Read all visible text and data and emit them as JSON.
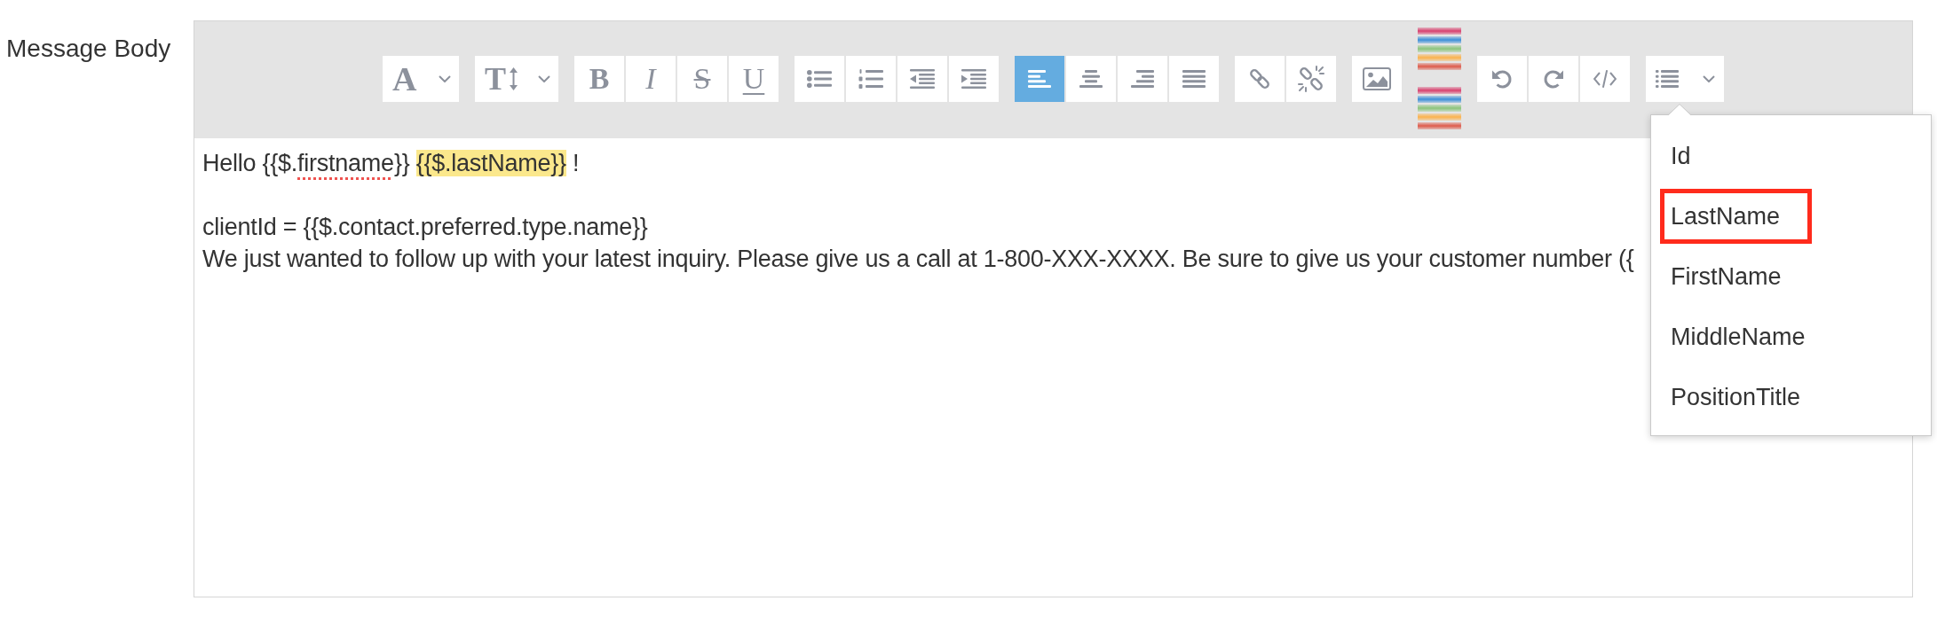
{
  "form_field": {
    "label": "Message Body"
  },
  "toolbar": {
    "groups": [
      {
        "items": [
          {
            "kind": "font",
            "label": "A"
          }
        ]
      },
      {
        "items": [
          {
            "kind": "size",
            "label": "T"
          }
        ]
      },
      {
        "items": [
          {
            "kind": "bold",
            "label": "B"
          },
          {
            "kind": "italic",
            "label": "I"
          },
          {
            "kind": "strike",
            "label": "S"
          },
          {
            "kind": "underline",
            "label": "U"
          }
        ]
      },
      {
        "items": [
          {
            "kind": "bullets"
          },
          {
            "kind": "numbers"
          },
          {
            "kind": "outdent"
          },
          {
            "kind": "indent"
          }
        ]
      },
      {
        "items": [
          {
            "kind": "left",
            "selected": true
          },
          {
            "kind": "center",
            "selected": false
          },
          {
            "kind": "right",
            "selected": false
          },
          {
            "kind": "justify",
            "selected": false
          }
        ]
      },
      {
        "items": [
          {
            "kind": "link"
          },
          {
            "kind": "unlink"
          }
        ]
      },
      {
        "items": [
          {
            "kind": "image"
          }
        ]
      },
      {
        "items": [
          {
            "kind": "palette"
          },
          {
            "kind": "palette"
          }
        ]
      },
      {
        "items": [
          {
            "kind": "undo"
          },
          {
            "kind": "redo"
          },
          {
            "kind": "code"
          }
        ]
      },
      {
        "items": [
          {
            "kind": "fields",
            "expanded": true
          }
        ]
      }
    ]
  },
  "editor": {
    "lines": [
      {
        "kind": "text",
        "segments": [
          {
            "kind": "plain",
            "text": "Hello {{$."
          },
          {
            "kind": "misspelled",
            "text": "firstname"
          },
          {
            "kind": "plain",
            "text": "}} "
          },
          {
            "kind": "highlight",
            "text": "{{$.lastName}}"
          },
          {
            "kind": "plain",
            "text": " !"
          }
        ]
      },
      {
        "kind": "blank"
      },
      {
        "kind": "text",
        "segments": [
          {
            "kind": "plain",
            "text": "clientId = {{$.contact.preferred.type.name}}"
          }
        ]
      },
      {
        "kind": "text",
        "segments": [
          {
            "kind": "plain",
            "text": "We just wanted to follow up with your latest inquiry. Please give us a call at 1-800-XXX-XXXX. Be sure to give us your customer number ({"
          }
        ]
      }
    ]
  },
  "fields_menu": {
    "items": [
      {
        "label": "Id",
        "highlighted": false
      },
      {
        "label": "LastName",
        "highlighted": true
      },
      {
        "label": "FirstName",
        "highlighted": false
      },
      {
        "label": "MiddleName",
        "highlighted": false
      },
      {
        "label": "PositionTitle",
        "highlighted": false
      }
    ]
  }
}
